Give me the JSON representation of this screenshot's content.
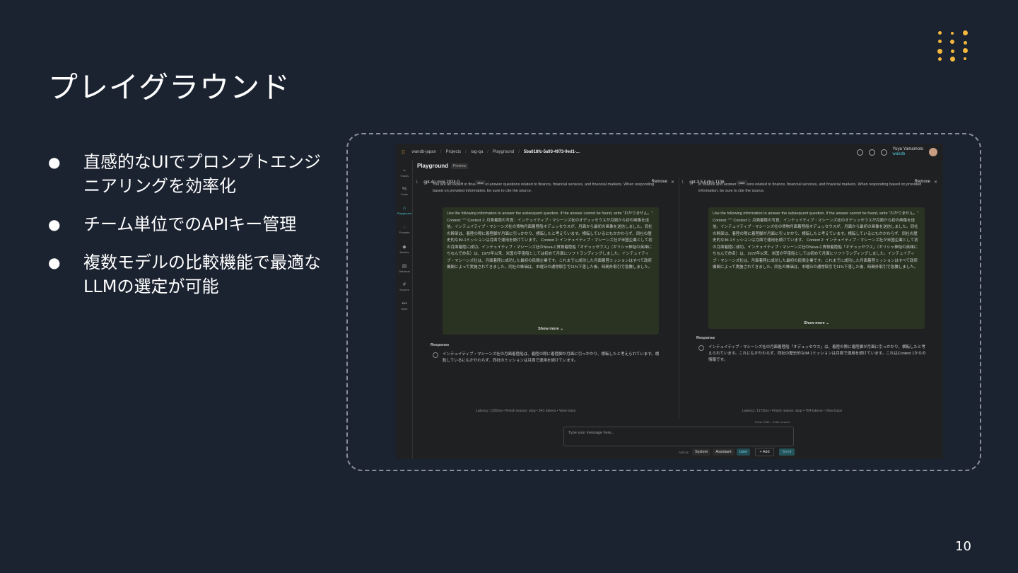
{
  "slide": {
    "title": "プレイグラウンド",
    "bullets": [
      "直感的なUIでプロンプトエンジニアリングを効率化",
      "チーム単位でのAPIキー管理",
      "複数モデルの比較機能で最適なLLMの選定が可能"
    ],
    "page_number": "10",
    "bullet_glyph": "●"
  },
  "app": {
    "breadcrumb": [
      "wandb-japan",
      "Projects",
      "rag-qa",
      "Playground",
      "5ba618fc-5a93-4973-9ed1-..."
    ],
    "user_name": "Yuya Yamamoto",
    "user_org": "wandb",
    "page_title": "Playground",
    "page_badge": "Preview",
    "sidebar": [
      "Traces",
      "Evals",
      "Playground",
      "Prompts",
      "Models",
      "Datasets",
      "Scorers",
      "More"
    ],
    "left_panel": {
      "index": "1",
      "model": "gpt-4o-mini-2024-0...",
      "chip": "3862",
      "remove_label": "Remove",
      "system_text": "You are an expert in finance and answer questions related to finance, financial services, and financial markets. When responding based on provided information, be sure to cite the source.",
      "context_text": "Use the following information to answer the subsequent question. If the answer cannot be found, write \"わかりません。\" Context: \"\"\" Context 1: 月面着陸の写真：インテュイティブ・マシーンズ社のオデュッセウスが月面から初の画像を送信。インテュイティブ・マシーンズ社の貨物月面着陸船オデュッセウスが、月面から最初の画像を送信しました。同社の幹部は、着陸の際に着陸脚が月面に引っかかり、横転したと考えています。横転しているにもかかわらず、同社の歴史的なIM-1ミッションは月面で運用を続けています。 Context 2: インテュイティブ・マシーンズ社が米国企業として初の月面着陸に成功。インテュイティブ・マシーンズ社のNova-C貨物着陸船「オデュッセウス」（ギリシャ神話の英雄にちなんで命名）は、1972年以来、米国の宇宙船としては初めて月面にソフトランディングしました。インテュイティブ・マシーンズ社は、月面着陸に成功した最初の民間企業です。これまでに成功した月面着陸ミッションはすべて政府機関によって実施されてきました。同社の株価は、木曜日の通常取引で11%下落した後、時間外取引で急騰しました。",
      "show_more": "Show more",
      "response_label": "Response",
      "response_text": "インテュイティブ・マシーンズ社の月面着陸船は、着陸の際に着陸脚が月面に引っかかり、横転したと考えられています。横転しているにもかかわらず、同社のミッションは月面で運用を続けています。",
      "stats": "Latency: 1105ms  •  Finish reason: stop  •  541 tokens  •  View trace"
    },
    "right_panel": {
      "index": "1",
      "model": "gpt-3.5-turbo-1106",
      "chip": "9a8b",
      "remove_label": "Remove",
      "system_text": "in finance and answer questions related to finance, financial services, and financial markets. When responding based on provided information, be sure to cite the source.",
      "context_text": "Use the following information to answer the subsequent question. If the answer cannot be found, write \"わかりません。\" Context: \"\"\" Context 1: 月面着陸の写真：インテュイティブ・マシーンズ社のオデュッセウスが月面から初の画像を送信。インテュイティブ・マシーンズ社の貨物月面着陸船オデュッセウスが、月面から最初の画像を送信しました。同社の幹部は、着陸の際に着陸脚が月面に引っかかり、横転したと考えています。横転しているにもかかわらず、同社の歴史的なIM-1ミッションは月面で運用を続けています。 Context 2: インテュイティブ・マシーンズ社が米国企業として初の月面着陸に成功。インテュイティブ・マシーンズ社のNova-C貨物着陸船「オデュッセウス」（ギリシャ神話の英雄にちなんで命名）は、1972年以来、米国の宇宙船としては初めて月面にソフトランディングしました。インテュイティブ・マシーンズ社は、月面着陸に成功した最初の民間企業です。これまでに成功した月面着陸ミッションはすべて政府機関によって実施されてきました。同社の株価は、木曜日の通常取引で11%下落した後、時間外取引で急騰しました。",
      "show_more": "Show more",
      "response_label": "Response",
      "response_text": "インテュイティブ・マシーンズ社の月面着陸船「オデュッセウス」は、着陸の際に着陸脚が月面に引っかかり、横転したと考えられています。これにもかかわらず、同社の歴史的なIM-1ミッションは月面で運用を続けています。これはContext 1からの情報です。",
      "stats": "Latency: 1173ms  •  Finish reason: stop  •  704 tokens  •  View trace"
    },
    "composer": {
      "placeholder": "Type your message here...",
      "hint": "Press CMD + Enter to send",
      "add_as_label": "Add as",
      "roles": [
        "System",
        "Assistant",
        "User"
      ],
      "add_label": "+ Add",
      "send_label": "Send"
    }
  },
  "colors": {
    "background": "#1b2230",
    "accent": "#4ec9d8",
    "logo": "#f5b83d"
  }
}
